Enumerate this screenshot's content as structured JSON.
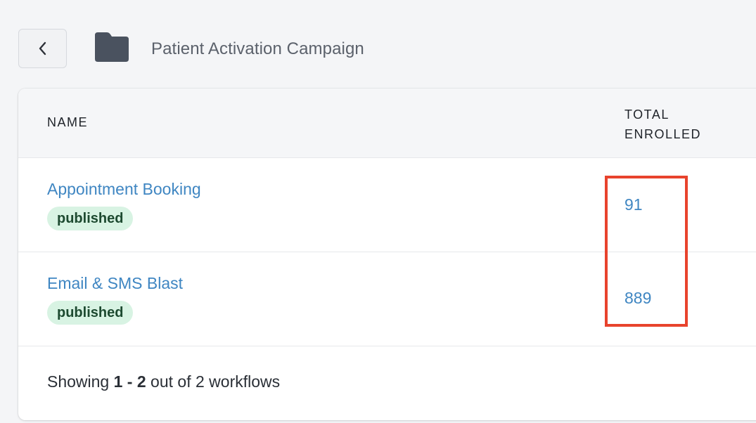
{
  "header": {
    "title": "Patient Activation Campaign",
    "back_icon": "chevron-left-icon",
    "folder_icon": "folder-icon"
  },
  "table": {
    "columns": {
      "name": "NAME",
      "total_enrolled_line1": "TOTAL",
      "total_enrolled_line2": "ENROLLED"
    },
    "rows": [
      {
        "name": "Appointment Booking",
        "status": "published",
        "total_enrolled": "91"
      },
      {
        "name": "Email & SMS Blast",
        "status": "published",
        "total_enrolled": "889"
      }
    ]
  },
  "footer": {
    "prefix": "Showing ",
    "range": "1 - 2",
    "suffix": " out of 2 workflows"
  },
  "colors": {
    "link": "#3f86c2",
    "badge_bg": "#d8f3e3",
    "badge_text": "#1d4a30",
    "highlight": "#e8432d"
  }
}
